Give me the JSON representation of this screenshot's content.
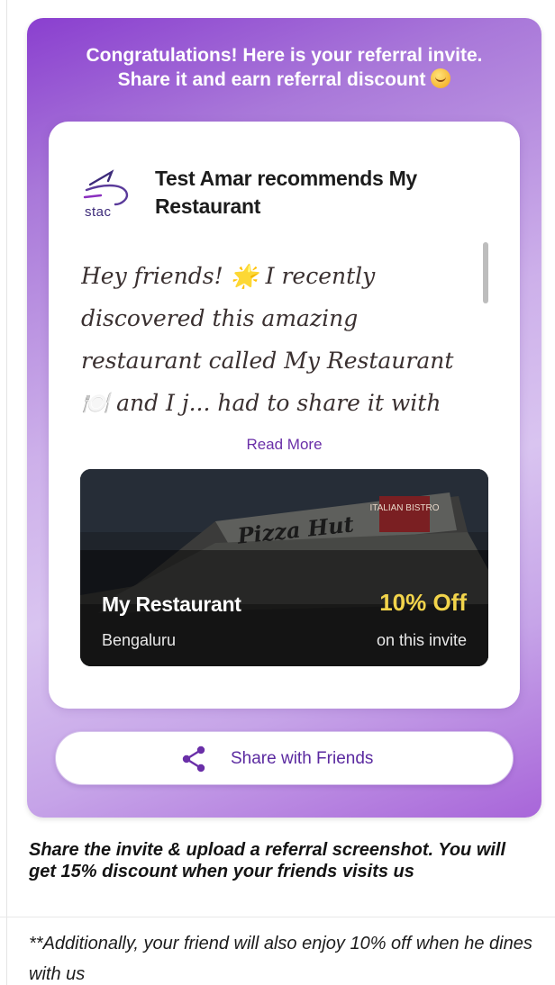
{
  "referral": {
    "congrats_line1": "Congratulations! Here is your referral invite.",
    "congrats_line2": "Share it and earn referral discount",
    "emoji_icon": "blushing-face-emoji"
  },
  "card": {
    "logo_text": "stac",
    "headline": "Test Amar recommends My Restaurant",
    "message": "Hey friends! 🌟 I recently discovered this amazing restaurant called My Restaurant 🍽️ and I j... had to share it with you all! The",
    "read_more": "Read More"
  },
  "restaurant": {
    "name": "My Restaurant",
    "city": "Bengaluru",
    "discount": "10% Off",
    "discount_sub": "on this invite",
    "sign_text": "Pizza Hut",
    "sign_sub": "ITALIAN BISTRO"
  },
  "share": {
    "label": "Share with Friends",
    "icon": "share-icon"
  },
  "info": {
    "text": "Share the invite & upload a referral screenshot. You will get 15% discount when your friends visits us",
    "note": "**Additionally, your friend will also enjoy 10% off when he dines with us"
  },
  "colors": {
    "accent": "#6a2fa8",
    "gradient_start": "#8a3fcf",
    "gradient_end": "#a865d9",
    "discount": "#f2d44b"
  }
}
